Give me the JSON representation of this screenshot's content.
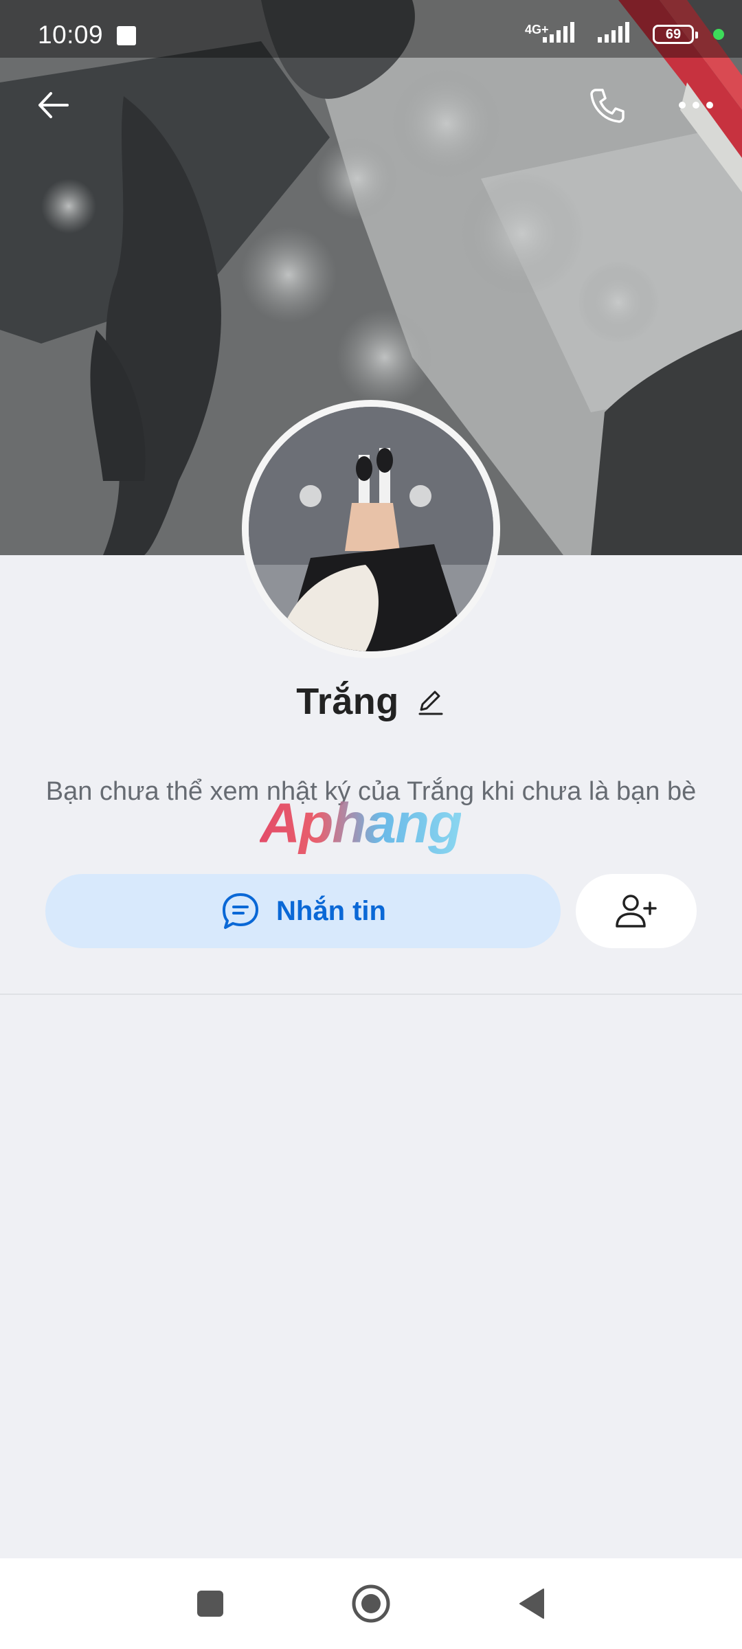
{
  "status_bar": {
    "time": "10:09",
    "network": "4G+",
    "battery": "69"
  },
  "profile": {
    "name": "Trắng",
    "info": "Bạn chưa thể xem nhật ký của Trắng khi chưa là bạn bè"
  },
  "watermark": "Aphang",
  "actions": {
    "message_label": "Nhắn tin"
  },
  "icons": {
    "back": "back-arrow-icon",
    "call": "phone-icon",
    "more": "more-dots-icon",
    "edit": "pencil-icon",
    "message": "chat-bubble-icon",
    "add_friend": "add-friend-icon",
    "nav_recent": "square-icon",
    "nav_home": "circle-icon",
    "nav_back": "triangle-back-icon"
  },
  "colors": {
    "accent": "#0a68d6",
    "message_button_bg": "#d8e9fc",
    "page_bg": "#eff0f4"
  }
}
